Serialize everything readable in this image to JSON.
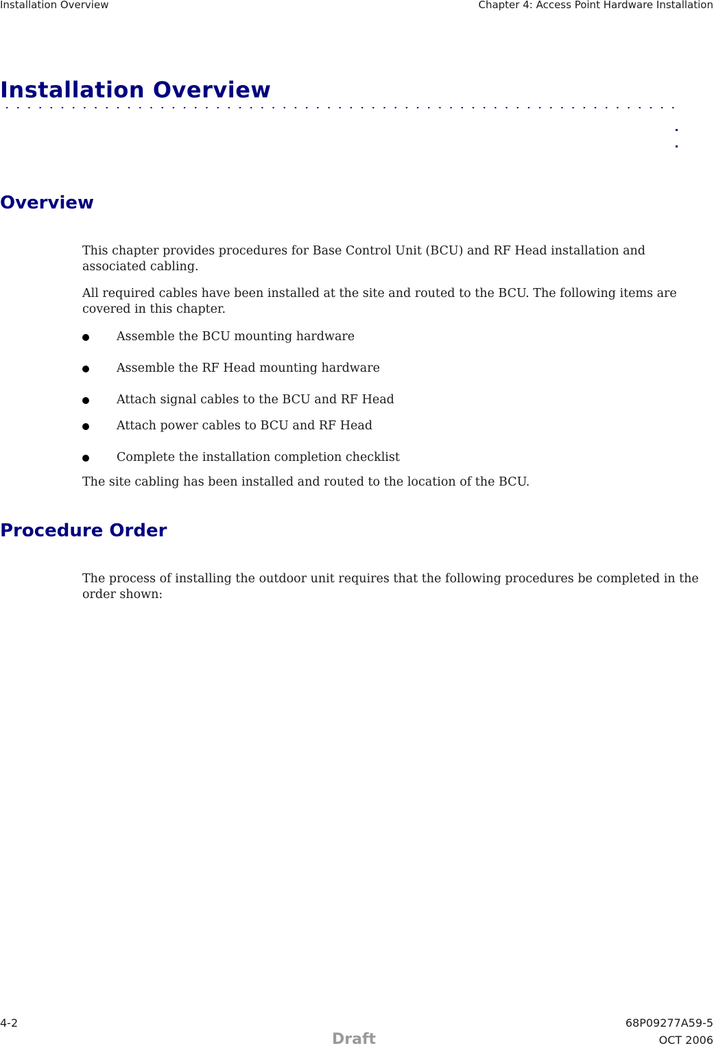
{
  "header": {
    "left": "Installation Overview",
    "right": "Chapter 4:  Access Point Hardware Installation"
  },
  "title": "Installation Overview",
  "sections": [
    {
      "heading": "Overview",
      "paragraphs": [
        "This chapter provides procedures for Base Control Unit (BCU) and RF Head installation and associated cabling.",
        "All required cables have been installed at the site and routed to the BCU. The following items are covered in this chapter."
      ],
      "bullets": [
        "Assemble the BCU mounting hardware",
        "Assemble the RF Head mounting hardware",
        "Attach signal cables to the BCU and RF Head",
        "Attach power cables to BCU and RF Head",
        "Complete the installation completion checklist"
      ],
      "closing": "The site cabling has been installed and routed to the location of the BCU."
    },
    {
      "heading": "Procedure Order",
      "paragraphs": [
        "The process of installing the outdoor unit requires that the following procedures be completed in the order shown:"
      ]
    }
  ],
  "footer": {
    "page_number": "4-2",
    "doc_number": "68P09277A59-5",
    "watermark": "Draft",
    "date": "OCT 2006"
  },
  "colors": {
    "heading": "#000080",
    "text": "#1a1a1a",
    "draft": "#9a9a9a"
  }
}
